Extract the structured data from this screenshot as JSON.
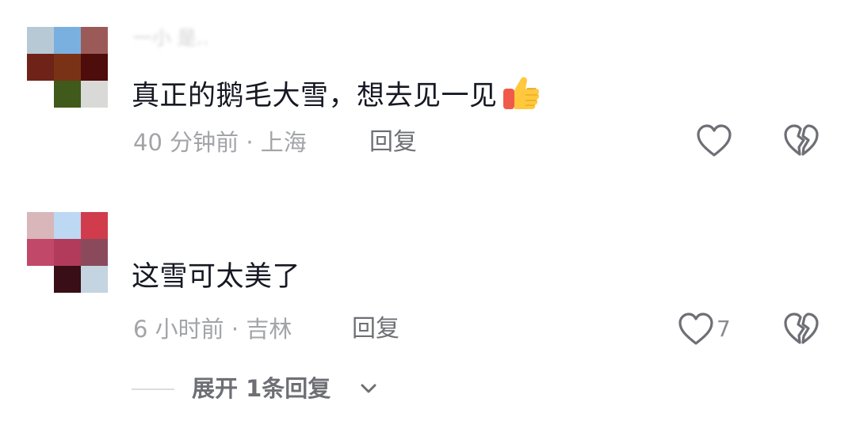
{
  "comments": [
    {
      "username": "一小 是…",
      "avatar_colors": [
        "#b8c9d6",
        "#7ab0e0",
        "#9b5a58",
        "#6e2218",
        "#7a3216",
        "#4e0c0a",
        "#ffffff",
        "#3f5a1a",
        "#d9dad8"
      ],
      "text": "真正的鹅毛大雪，想去见一见",
      "emoji_icon": "thumbs-up-icon",
      "meta": "40 分钟前 · 上海",
      "reply_label": "回复",
      "like_count": "",
      "like_icon": "heart-outline-icon",
      "dislike_icon": "broken-heart-icon"
    },
    {
      "username": "",
      "avatar_colors": [
        "#d8b6ba",
        "#bcd8f2",
        "#d03c4c",
        "#c2486a",
        "#b23a5a",
        "#8a4a5c",
        "#ffffff",
        "#3a0e16",
        "#c4d4e0"
      ],
      "text": "这雪可太美了",
      "meta": "6 小时前 · 吉林",
      "reply_label": "回复",
      "like_count": "7",
      "like_icon": "heart-outline-icon",
      "dislike_icon": "broken-heart-icon",
      "expand_label": "展开 1条回复"
    }
  ],
  "colors": {
    "text_primary": "#161823",
    "text_secondary": "#a3a4a8",
    "icon": "#6e6f75"
  }
}
